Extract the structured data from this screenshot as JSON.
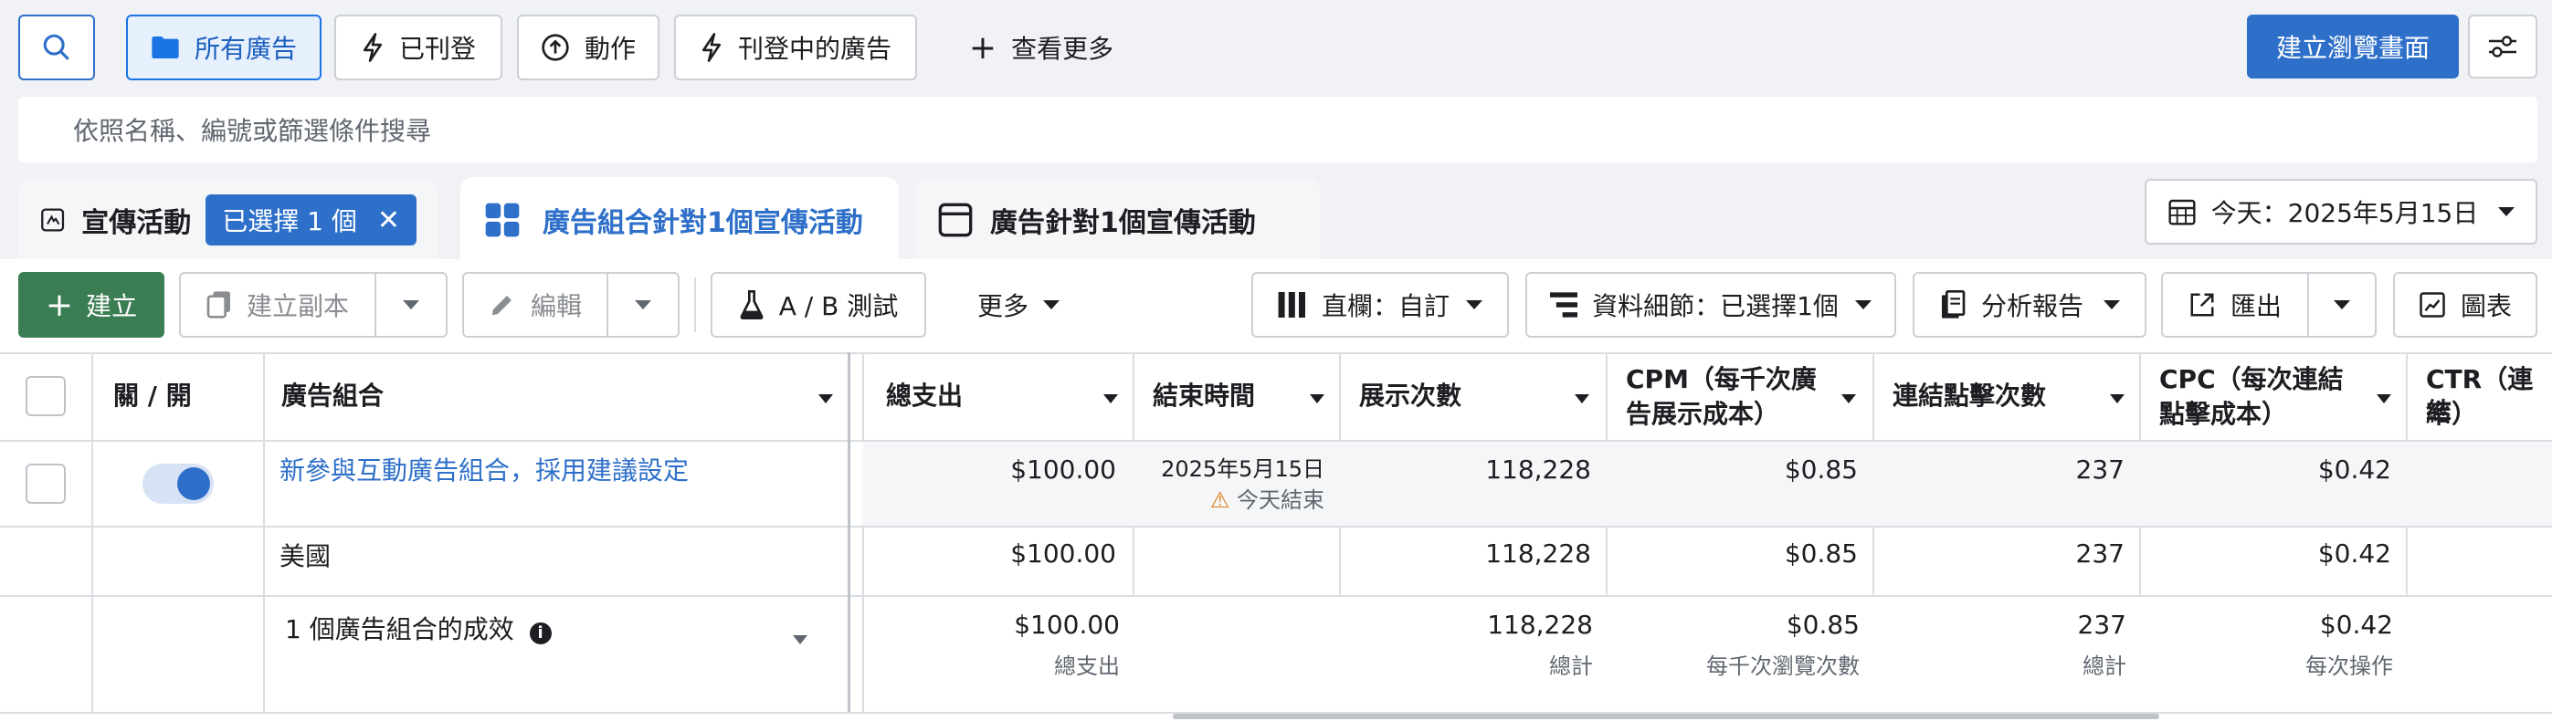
{
  "filters": {
    "all_ads": "所有廣告",
    "published": "已刊登",
    "actions": "動作",
    "active_ads": "刊登中的廣告",
    "see_more": "查看更多",
    "create_view": "建立瀏覽畫面"
  },
  "search": {
    "placeholder": "依照名稱、編號或篩選條件搜尋"
  },
  "tabs": {
    "campaigns": "宣傳活動",
    "selected_chip": "已選擇 1 個",
    "adsets": "廣告組合針對1個宣傳活動",
    "ads": "廣告針對1個宣傳活動"
  },
  "date_range": "今天：2025年5月15日",
  "toolbar": {
    "create": "建立",
    "duplicate": "建立副本",
    "edit": "編輯",
    "ab_test": "A / B 測試",
    "more": "更多",
    "columns": "直欄：自訂",
    "breakdown": "資料細節：已選擇1個",
    "reports": "分析報告",
    "export": "匯出",
    "charts": "圖表"
  },
  "table": {
    "headers": {
      "toggle": "關 / 開",
      "adset": "廣告組合",
      "spend": "總支出",
      "end_time": "結束時間",
      "impressions": "展示次數",
      "cpm_1": "CPM（每千次廣",
      "cpm_2": "告展示成本）",
      "link_clicks": "連結點擊次數",
      "cpc_1": "CPC（每次連結",
      "cpc_2": "點擊成本）",
      "ctr_1": "CTR（連結",
      "ctr_2": "率）"
    },
    "row1": {
      "name": "新參與互動廣告組合，採用建議設定",
      "spend": "$100.00",
      "end_date": "2025年5月15日",
      "end_note": "今天結束",
      "impressions": "118,228",
      "cpm": "$0.85",
      "link_clicks": "237",
      "cpc": "$0.42"
    },
    "row2": {
      "name": "美國",
      "spend": "$100.00",
      "impressions": "118,228",
      "cpm": "$0.85",
      "link_clicks": "237",
      "cpc": "$0.42"
    },
    "summary": {
      "label": "1 個廣告組合的成效",
      "spend": "$100.00",
      "spend_sub": "總支出",
      "impressions": "118,228",
      "impressions_sub": "總計",
      "cpm": "$0.85",
      "cpm_sub": "每千次瀏覽次數",
      "link_clicks": "237",
      "link_clicks_sub": "總計",
      "cpc": "$0.42",
      "cpc_sub": "每次操作"
    }
  },
  "colors": {
    "accent": "#2d6fc9",
    "create_green": "#3a7d52",
    "warning": "#e07b1a"
  }
}
